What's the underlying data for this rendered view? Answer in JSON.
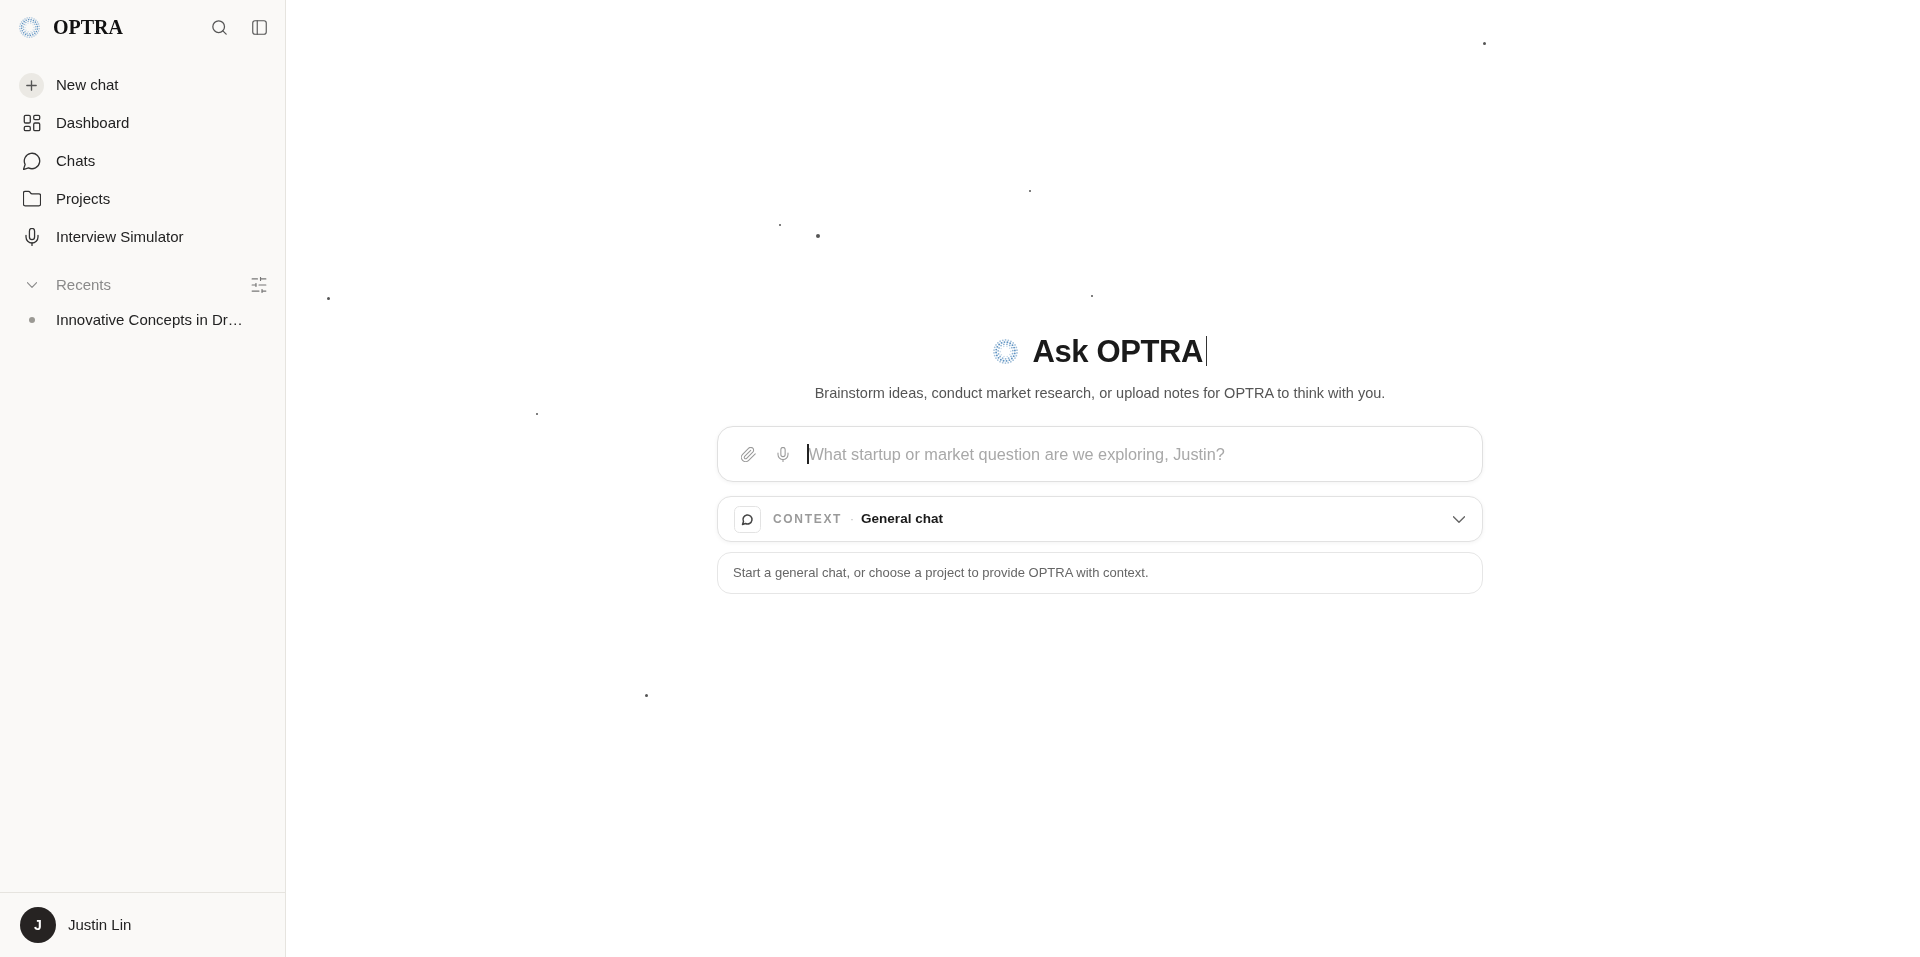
{
  "sidebar": {
    "logo": "OPTRA",
    "nav": [
      {
        "kind": "action",
        "label": "New chat"
      },
      {
        "kind": "link",
        "label": "Dashboard"
      },
      {
        "kind": "link",
        "label": "Chats"
      },
      {
        "kind": "link",
        "label": "Projects"
      },
      {
        "kind": "link",
        "label": "Interview Simulator"
      }
    ],
    "recents": {
      "title": "Recents",
      "expanded": true,
      "items": [
        {
          "label": "Innovative Concepts in Dr…"
        }
      ]
    },
    "user": {
      "initial": "J",
      "name": "Justin Lin"
    }
  },
  "main": {
    "title": "Ask OPTRA",
    "subtitle": "Brainstorm ideas, conduct market research, or upload notes for OPTRA to think with you.",
    "composer": {
      "placeholder": "What startup or market question are we exploring, Justin?"
    },
    "context": {
      "label": "CONTEXT",
      "separator": "·",
      "value": "General chat"
    },
    "hint": "Start a general chat, or choose a project to provide OPTRA with context."
  }
}
